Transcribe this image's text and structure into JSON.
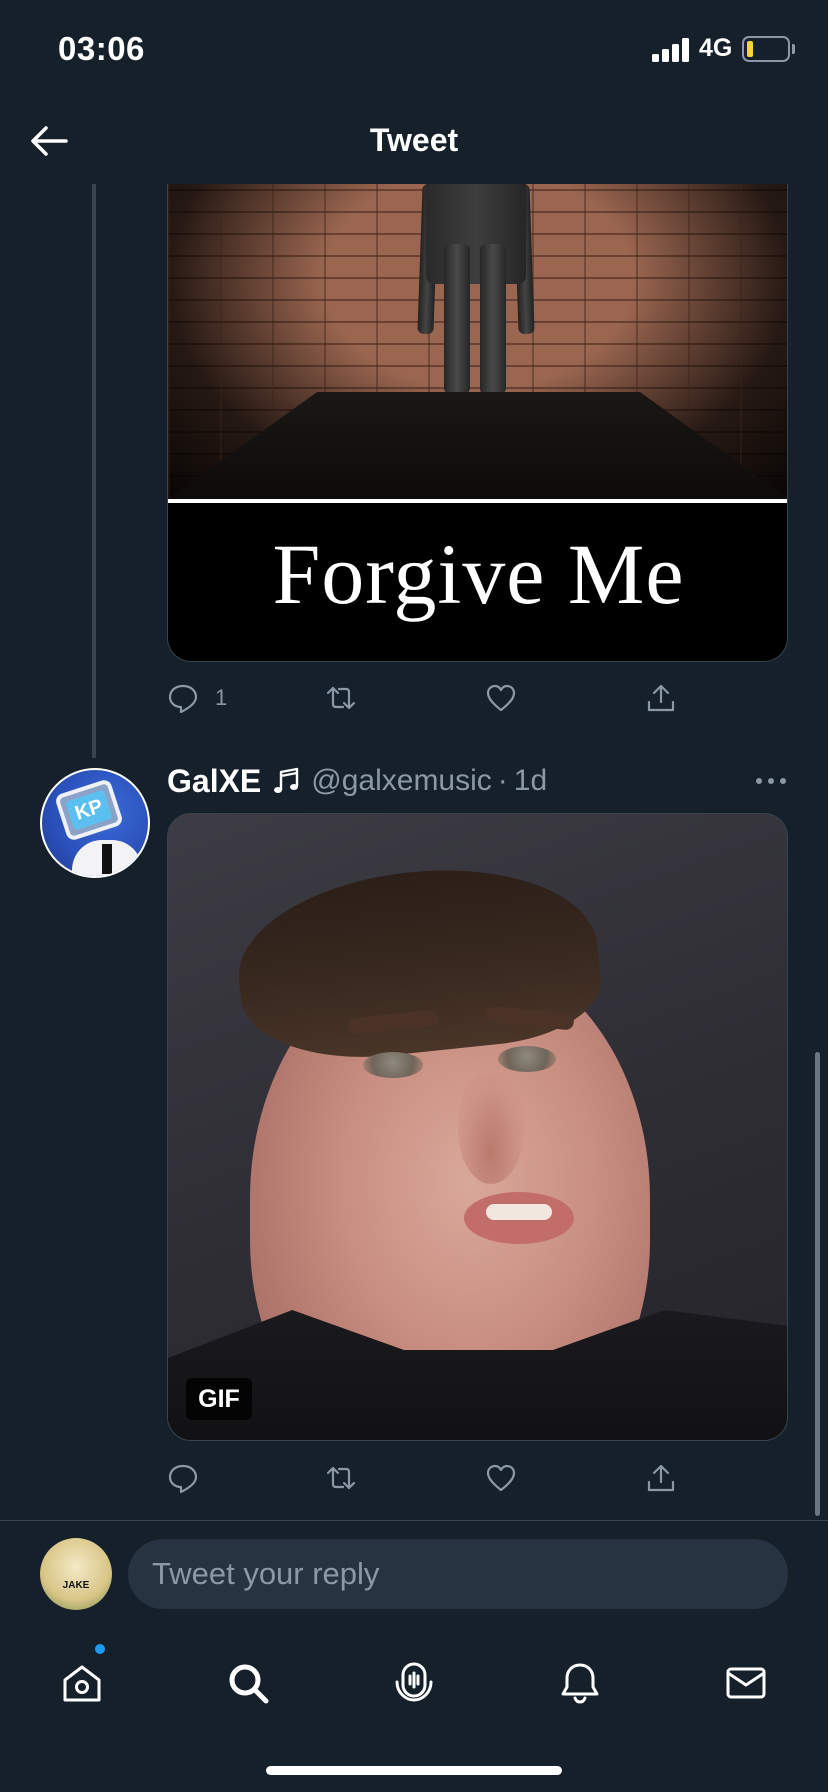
{
  "status_bar": {
    "time": "03:06",
    "network": "4G"
  },
  "header": {
    "title": "Tweet"
  },
  "previous_tweet": {
    "media_caption": "Forgive Me",
    "reply_count": "1"
  },
  "tweet": {
    "display_name": "GalXE",
    "handle": "@galxemusic",
    "separator": "·",
    "timestamp": "1d",
    "media_badge": "GIF",
    "avatar_text": "KP"
  },
  "reply": {
    "placeholder": "Tweet your reply",
    "avatar_label": "JAKE"
  },
  "tabs": [
    {
      "name": "home",
      "icon": "home-icon",
      "has_notification": true
    },
    {
      "name": "search",
      "icon": "search-icon"
    },
    {
      "name": "spaces",
      "icon": "spaces-microphone-icon"
    },
    {
      "name": "notifications",
      "icon": "bell-icon"
    },
    {
      "name": "messages",
      "icon": "envelope-icon"
    }
  ],
  "colors": {
    "background": "#15202b",
    "secondary_text": "#8b98a5",
    "divider": "#38444d",
    "accent": "#1d9bf0",
    "battery_low": "#f7d33a"
  }
}
